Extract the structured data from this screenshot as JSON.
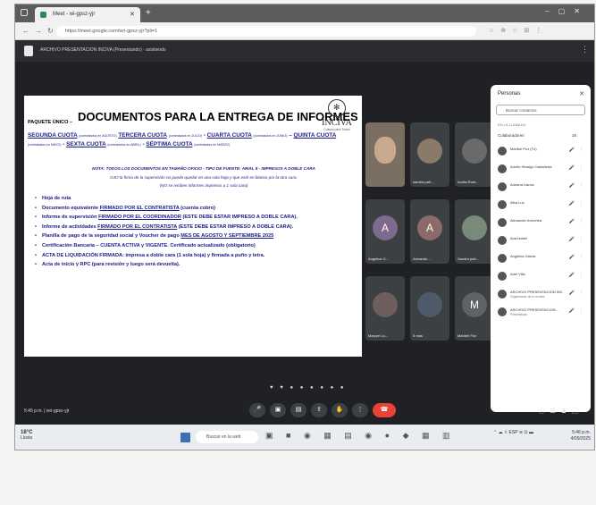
{
  "browser": {
    "tab_title": "Meet - wi-gpsz-yjr",
    "url": "https://meet.google.com/wri-gpsz-yjr?pli=1"
  },
  "meet": {
    "presenting_label": "ARCHIVO PRESENTACION INCIVA (Presentando) · asistiendo",
    "time_label": "5:45 p.m.  |  wri-gpsz-yjr"
  },
  "slide": {
    "title": "DOCUMENTOS PARA LA ENTREGA DE INFORMES",
    "paquete": "PAQUETE ÚNICO –",
    "logo_text": "INCIVA",
    "logo_sub": "Cultura para Todos",
    "cuotas": [
      {
        "label": "SEGUNDA CUOTA",
        "note": "(contratados en AGOSTO)",
        "sep": " "
      },
      {
        "label": "TERCERA CUOTA",
        "note": "(contratados en JULIO)",
        "sep": " - "
      },
      {
        "label": "CUARTA CUOTA",
        "note": "(contratados en JUNIO)",
        "sep": " – "
      },
      {
        "label": "QUINTA CUOTA",
        "note": "(contratados en MAYO)",
        "sep": " - "
      },
      {
        "label": "SEXTA CUOTA",
        "note": "(contratados en ABRIL)",
        "sep": " - "
      },
      {
        "label": "SÉPTIMA CUOTA",
        "note": "(contratados en MARZO)",
        "sep": ""
      }
    ],
    "note1": "NOTA: TODOS LOS DOCUMENTOS EN TAMAÑO OFICIO - TIPO DE FUENTE: ARIAL 8 - IMPRESOS A DOBLE CARA",
    "note2": "OJO la firma de la supervisión no puede quedar en una sola hoja y que esté en blanco por la otra cara.",
    "note3": "(NO se reciben informes impresos a 1 sola cara)",
    "requirements": [
      {
        "pre": "Hoja de ruta",
        "u": "",
        "post": ""
      },
      {
        "pre": "Documento equivalente ",
        "u": "FIRMADO POR EL CONTRATISTA",
        "post": " (cuenta cobro)"
      },
      {
        "pre": "Informe de supervisión ",
        "u": "FIRMADO POR EL COORDINADOR",
        "post": " (ESTE DEBE ESTAR IMPRESO A DOBLE CARA)."
      },
      {
        "pre": "Informe de actividades ",
        "u": "FIRMADO POR EL CONTRATISTA",
        "post": " (ESTE DEBE ESTAR IMPRESO A DOBLE CARA)."
      },
      {
        "pre": "Planilla de pago de la seguridad social y Voucher de pago ",
        "u": "MES DE AGOSTO Y SEPTIEMBRE 2025",
        "post": ""
      },
      {
        "pre": "Certificación Bancaria – CUENTA ACTIVA y VIGENTE. Certificado actualizado (obligatorio)",
        "u": "",
        "post": ""
      },
      {
        "pre": "ACTA DE LIQUIDACIÓN FIRMADA: impresa a doble cara (1 sola hoja) y firmada a puño y letra.",
        "u": "",
        "post": ""
      },
      {
        "pre": "Acta de inicio y RPC (para revisión y luego será devuelta).",
        "u": "",
        "post": ""
      }
    ]
  },
  "participants_grid": [
    {
      "name": "",
      "initial": "",
      "kind": "cam"
    },
    {
      "name": "sandra pati...",
      "initial": "",
      "kind": "photo",
      "color": "#8a7a6a"
    },
    {
      "name": "Aurita Rodr...",
      "initial": "",
      "kind": "photo",
      "color": "#6a6a6a"
    },
    {
      "name": "Angelica G...",
      "initial": "A",
      "kind": "initial",
      "color": "#7e6a8c"
    },
    {
      "name": "Armando ...",
      "initial": "A",
      "kind": "initial",
      "color": "#8c6a6a"
    },
    {
      "name": "Sandra pati...",
      "initial": "",
      "kind": "photo",
      "color": "#7a8a7a"
    },
    {
      "name": "Maryori Lo...",
      "initial": "",
      "kind": "photo",
      "color": "#6e5e5e"
    },
    {
      "name": "5 más",
      "initial": "",
      "kind": "photo",
      "color": "#4e5a6a"
    },
    {
      "name": "Maribel Flor",
      "initial": "M",
      "kind": "initial",
      "color": "#5f6368"
    }
  ],
  "people_panel": {
    "title": "Personas",
    "search_placeholder": "Buscar contactos",
    "section": "EN LA LLAMADA",
    "group": "Colaboradores",
    "count": "16",
    "list": [
      {
        "name": "Maribel Flor (Tú)",
        "role": ""
      },
      {
        "name": "Adolfo Hidalgo Castañeda",
        "role": ""
      },
      {
        "name": "Adriana Llanos",
        "role": ""
      },
      {
        "name": "Alba Luz",
        "role": ""
      },
      {
        "name": "Alexander Arrechea",
        "role": ""
      },
      {
        "name": "Ana Isabel",
        "role": ""
      },
      {
        "name": "Angelica Garcia",
        "role": ""
      },
      {
        "name": "Ariel Villa",
        "role": ""
      },
      {
        "name": "ARCHIVO PRESENTACION INC",
        "role": "Organizador de la reunión"
      },
      {
        "name": "ARCHIVO PRESENTACION...",
        "role": "Presentando"
      }
    ]
  },
  "taskbar": {
    "weather_temp": "18°C",
    "weather_desc": "Lluvia",
    "search_placeholder": "Buscar en la web",
    "lang": "ESP\nLAA",
    "time": "5:46 p.m.",
    "date": "4/09/2025"
  }
}
